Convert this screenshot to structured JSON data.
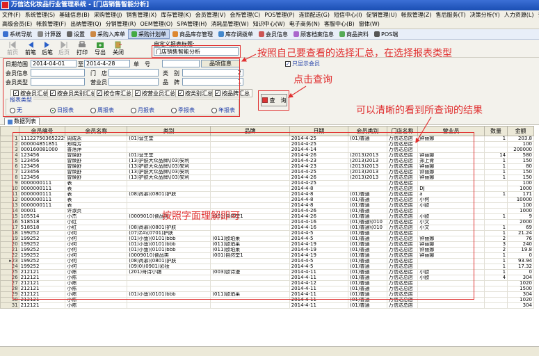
{
  "window": {
    "title": "万信达化妆品行业管理系统 - [门店销售智能分析]"
  },
  "menu": {
    "row1": [
      "文件(F)",
      "系统管理(S)",
      "基础信息(B)",
      "采购管理(J)",
      "销售管理(X)",
      "库存管理(K)",
      "会员管理(V)",
      "会所管理(C)",
      "POS管理(P)",
      "连锁配送(G)",
      "短信中心(I)",
      "促销管理(U)",
      "帐款管理(Z)",
      "售后服务(T)",
      "决策分析(Y)",
      "人力资源(L)",
      "试品管理(H)"
    ],
    "row2": [
      "高级会员(E)",
      "帐款管理(F)",
      "出纳管理(Q)",
      "分销管理(R)",
      "OEM管理(O)",
      "SPA管理(H)",
      "消耗品管理(W)",
      "知识中心(W)",
      "电子商务(N)",
      "客服中心(B)",
      "窗体(W)"
    ]
  },
  "nav": [
    "系统导航",
    "计算器",
    "设置",
    "采购入库单",
    "采购计划单",
    "商品库存管理",
    "库存调拨单",
    "会员信息",
    "顾客档案信息",
    "商品资料",
    "POS端"
  ],
  "actions": {
    "first": "前页",
    "prev": "前笔",
    "next": "后笔",
    "last": "后页",
    "print": "打印",
    "export": "导出",
    "close": "关闭"
  },
  "report": {
    "label": "自定义报表标题:",
    "title": "门店销售智能分析"
  },
  "filter": {
    "date_label": "日期范围",
    "date_from": "2014-04-01",
    "date_to": "2014-4-28",
    "to_label": "至",
    "number_label": "单　号",
    "product_info_label": "品项信息",
    "only_members_label": "只显示会员",
    "member_info_label": "会员信息",
    "store_label": "门　店",
    "category_label": "类　别",
    "category_value": "2",
    "member_type_label": "会员类型",
    "salesperson_label": "营业员",
    "brand_label": "品　牌",
    "brand_value": "1",
    "groups": [
      "按会员汇总",
      "按会员类别汇总",
      "按仓库汇总",
      "按营业员汇总",
      "按类别汇总",
      "按品牌汇总"
    ],
    "report_type_label": "报表类型",
    "report_types": [
      "无",
      "日报表",
      "周报表",
      "月报表",
      "季报表",
      "年报表"
    ],
    "report_type_selected": 1
  },
  "query_button": "查　询",
  "tab": "数据列表",
  "table": {
    "headers": [
      "会员编号",
      "会员名称",
      "类别",
      "品牌",
      "日期",
      "会员类别",
      "门店名称",
      "营业员",
      "数量",
      "金额"
    ],
    "rows": [
      [
        "1112275036522299€",
        "周成永",
        "(01)营生堂",
        "",
        "2014-4-25",
        "(01)普通",
        "万信达总店",
        "钟丽娜",
        "1",
        "203.8"
      ],
      [
        "000004851851",
        "郑晓芳",
        "",
        "",
        "2014-4-25",
        "",
        "万信达总店",
        "",
        "",
        "100"
      ],
      [
        "000160081000",
        "普落萍",
        "",
        "",
        "2014-4-14",
        "",
        "万信达总店",
        "",
        "",
        "200000"
      ],
      [
        "123456",
        "曾焕舒",
        "(01)营生堂",
        "",
        "2014-4-26",
        "(2013)2013",
        "万信达总店",
        "钟丽娜",
        "14",
        "580"
      ],
      [
        "123456",
        "曾焕舒",
        "(13)护肤大众品牌\\(03)安利",
        "",
        "2014-4-23",
        "(2013)2013",
        "万信达总店",
        "郑上肯",
        "1",
        "150"
      ],
      [
        "123456",
        "曾焕舒",
        "(13)护肤大众品牌\\(03)安利",
        "",
        "2014-4-23",
        "(2013)2013",
        "万信达总店",
        "钟丽娜",
        "1",
        "80"
      ],
      [
        "123456",
        "曾焕舒",
        "(13)护肤大众品牌\\(03)安利",
        "",
        "2014-4-25",
        "(2013)2013",
        "万信达总店",
        "钟丽娜",
        "1",
        "150"
      ],
      [
        "123456",
        "曾焕舒",
        "(13)护肤大众品牌\\(03)安利",
        "",
        "2014-4-26",
        "(2013)2013",
        "万信达总店",
        "钟丽娜",
        "1",
        "150"
      ],
      [
        "0000000111",
        "表",
        "",
        "",
        "2014-4-25",
        "",
        "万信达总店",
        "",
        "",
        "100"
      ],
      [
        "0000000111",
        "表",
        "",
        "",
        "2014-4-8",
        "",
        "万信达总店",
        "DJ",
        "",
        "1000"
      ],
      [
        "0000000111",
        "表",
        "(08)尚慕\\(0801)护肤",
        "",
        "2014-4-8",
        "(01)普通",
        "万信达总店",
        "a",
        "1",
        "171"
      ],
      [
        "0000000111",
        "表",
        "",
        "",
        "2014-4-8",
        "(01)普通",
        "万信达总店",
        "小何",
        "",
        "10000"
      ],
      [
        "0000000111",
        "表",
        "",
        "",
        "2014-4-8",
        "(01)普通",
        "万信达总店",
        "小欧",
        "",
        "100"
      ],
      [
        "00001",
        "许淑贞",
        "",
        "",
        "2014-4-26",
        "(01)普通",
        "万信达总店",
        "",
        "",
        "1000"
      ],
      [
        "105514",
        "小杰",
        "(0009010)食品类",
        "(001)自然堂1",
        "2014-4-26",
        "(01)普通",
        "万信达总店",
        "小欧",
        "1",
        "9"
      ],
      [
        "518518",
        "小红",
        "",
        "",
        "2014-4-16",
        "(01)普通\\(010",
        "万信达总店",
        "小文",
        "",
        "2000"
      ],
      [
        "518518",
        "小红",
        "(08)尚慕\\(0801)护肤",
        "",
        "2014-4-16",
        "(01)普通\\(010",
        "万信达总店",
        "小文",
        "1",
        "69"
      ],
      [
        "199252",
        "小何",
        "(07)ZA\\(0701)护肤",
        "",
        "2014-4-5",
        "(01)普通",
        "万信达总店",
        "",
        "1",
        "21.24"
      ],
      [
        "199252",
        "小何",
        "(01)小鱼\\(0101)bbb",
        "(011)欧珀莱",
        "2014-4-5",
        "(01)普通",
        "万信达总店",
        "钟丽娜",
        "2",
        "76"
      ],
      [
        "199252",
        "小何",
        "(01)小鱼\\(0101)bbb",
        "(011)欧珀莱",
        "2014-4-19",
        "(01)普通",
        "万信达总店",
        "钟丽娜",
        "3",
        "240"
      ],
      [
        "199252",
        "小何",
        "(01)小鱼\\(0101)bbb",
        "(011)欧珀莱",
        "2014-4-19",
        "(01)普通",
        "万信达总店",
        "钟丽娜",
        "2",
        "19.8"
      ],
      [
        "199252",
        "小何",
        "(0009010)食品类",
        "(001)自然堂1",
        "2014-4-19",
        "(01)普通",
        "万信达总店",
        "钟丽娜",
        "1",
        "0"
      ],
      [
        "199252",
        "小何",
        "(08)尚慕\\(0801)护肤",
        "",
        "2014-4-5",
        "(01)普通",
        "万信达总店",
        "",
        "1",
        "93.94"
      ],
      [
        "199252",
        "小何",
        "(09)0\\(0901)彩妆",
        "",
        "2014-4-5",
        "(01)普通",
        "万信达总店",
        "",
        "1",
        "17.32"
      ],
      [
        "212121",
        "小陈",
        "(201)哥诗小铺",
        "(003)欧诗漫",
        "2014-4-11",
        "(01)普通",
        "万信达总店",
        "小欧",
        "1",
        "0"
      ],
      [
        "212121",
        "小陈",
        "",
        "",
        "2014-4-11",
        "(01)普通",
        "万信达总店",
        "小欧",
        "4",
        "304"
      ],
      [
        "212121",
        "小陈",
        "",
        "",
        "2014-4-12",
        "(01)普通",
        "万信达总店",
        "",
        "",
        "1020"
      ],
      [
        "212121",
        "小陈",
        "",
        "",
        "2014-4-11",
        "(01)普通",
        "万信达总店",
        "",
        "",
        "1500"
      ],
      [
        "212121",
        "小陈",
        "(01)小鱼\\(0101)bbb",
        "(011)欧珀莱",
        "2014-4-11",
        "(01)普通",
        "万信达总店",
        "",
        "",
        "304"
      ],
      [
        "212121",
        "小陈",
        "",
        "",
        "2014-4-11",
        "(01)普通",
        "万信达总店",
        "",
        "",
        "1020"
      ],
      [
        "212121",
        "小陈",
        "",
        "",
        "2014-4-11",
        "(01)普通",
        "万信达总店",
        "",
        "",
        "304"
      ]
    ]
  },
  "annotations": {
    "select": "按照自己要查看的选择汇总，在选择报表类型",
    "query": "点击查询",
    "result": "可以清晰的看到所查询的结果",
    "field": "按照字面理解即可"
  }
}
